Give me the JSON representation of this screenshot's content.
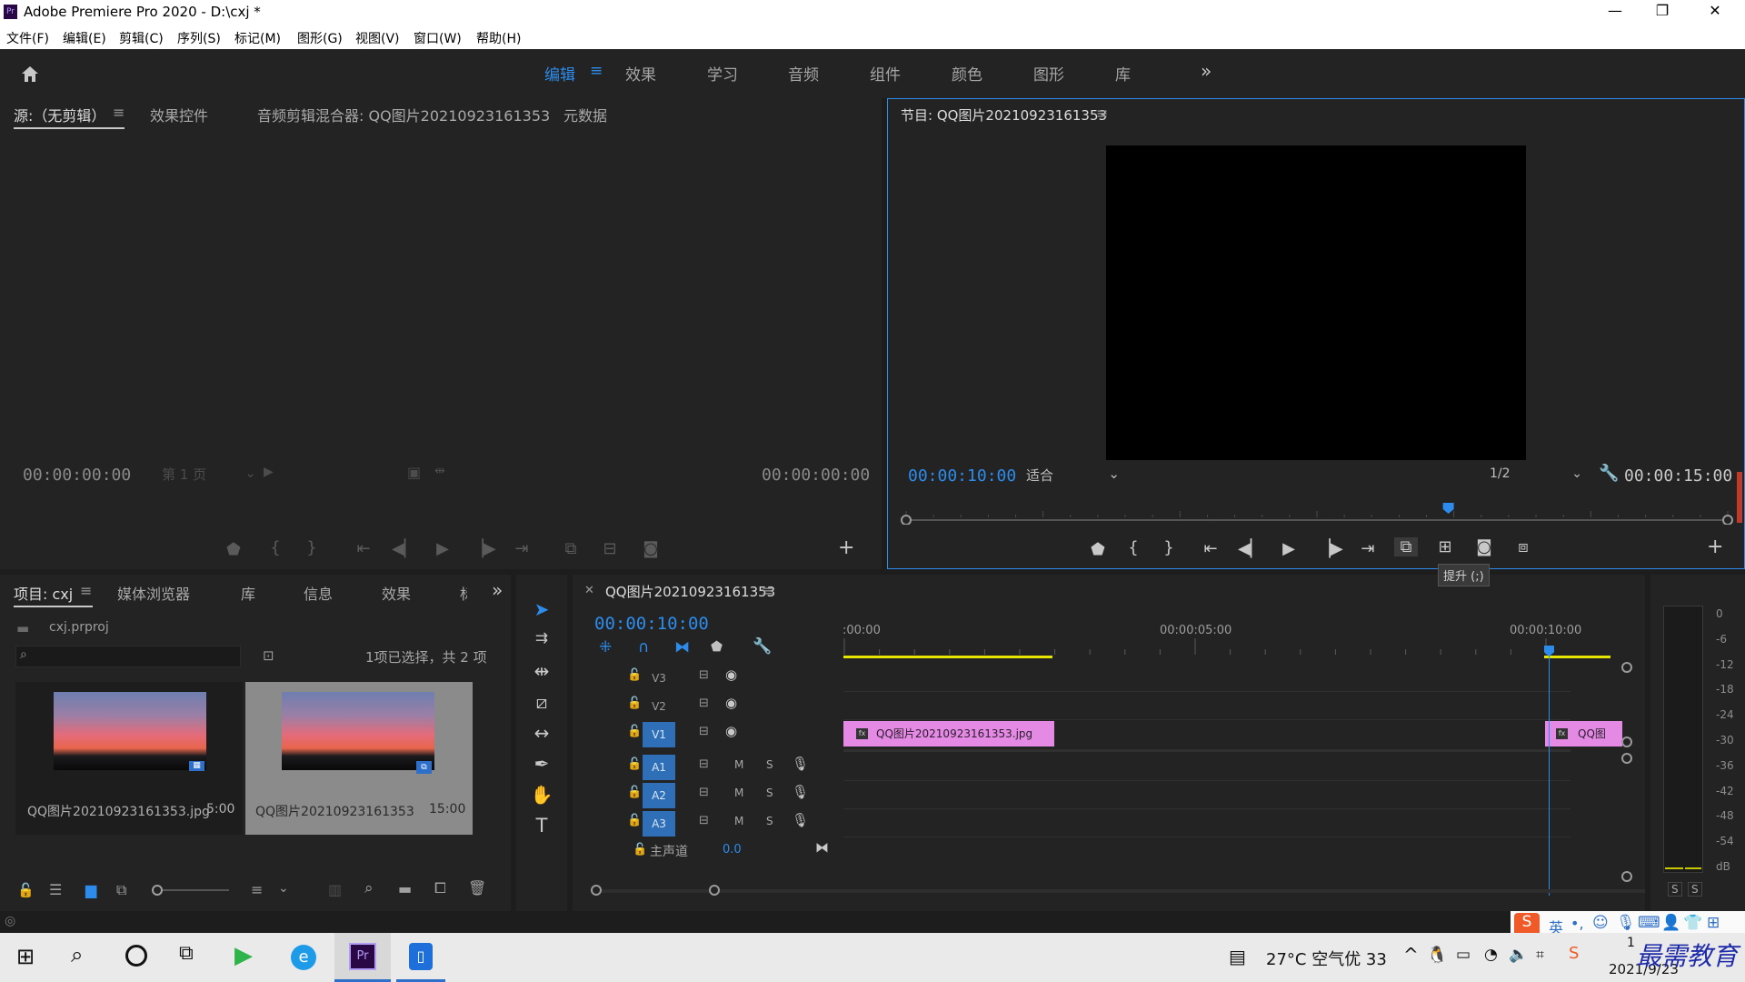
{
  "app": {
    "title": "Adobe Premiere Pro 2020 - D:\\cxj *"
  },
  "window_controls": {
    "minimize": "—",
    "maximize": "❐",
    "close": "✕"
  },
  "menu": [
    "文件(F)",
    "编辑(E)",
    "剪辑(C)",
    "序列(S)",
    "标记(M)",
    "图形(G)",
    "视图(V)",
    "窗口(W)",
    "帮助(H)"
  ],
  "workspaces": {
    "items": [
      "编辑",
      "效果",
      "学习",
      "音频",
      "组件",
      "颜色",
      "图形",
      "库"
    ],
    "active": "编辑",
    "more": "»"
  },
  "source_panel": {
    "tabs": [
      "源:（无剪辑）",
      "效果控件",
      "音频剪辑混合器: QQ图片20210923161353",
      "元数据"
    ],
    "tc_left": "00:00:00:00",
    "tc_right": "00:00:00:00",
    "page_select": "第 1 页"
  },
  "program_panel": {
    "title": "节目: QQ图片20210923161353",
    "tc_current": "00:00:10:00",
    "zoom": "适合",
    "resolution": "1/2",
    "tc_duration": "00:00:15:00",
    "tooltip": "提升 (;)",
    "playhead_fraction": 0.66
  },
  "project_panel": {
    "tabs": [
      "项目: cxj",
      "媒体浏览器",
      "库",
      "信息",
      "效果",
      "标"
    ],
    "file": "cxj.prproj",
    "selection_status": "1项已选择，共 2 项",
    "items": [
      {
        "name": "QQ图片20210923161353.jpg",
        "duration": "5:00",
        "selected": false
      },
      {
        "name": "QQ图片20210923161353",
        "duration": "15:00",
        "selected": true
      }
    ]
  },
  "timeline": {
    "title": "QQ图片20210923161353",
    "current_tc": "00:00:10:00",
    "ruler": [
      ":00:00",
      "00:00:05:00",
      "00:00:10:00"
    ],
    "tracks": {
      "video": [
        "V3",
        "V2",
        "V1"
      ],
      "audio": [
        "A1",
        "A2",
        "A3"
      ],
      "master": {
        "label": "主声道",
        "value": "0.0"
      }
    },
    "clips": [
      {
        "name": "QQ图片20210923161353.jpg",
        "track": "V1",
        "start": 0,
        "end": 3
      },
      {
        "name": "QQ图",
        "track": "V1",
        "start": 10,
        "end": 11.1
      }
    ],
    "playhead_seconds": 10
  },
  "meter": {
    "scale": [
      "0",
      "-6",
      "-12",
      "-18",
      "-24",
      "-30",
      "-36",
      "-42",
      "-48",
      "-54",
      "dB"
    ],
    "solo": [
      "S",
      "S"
    ]
  },
  "ime": {
    "label": "英"
  },
  "taskbar": {
    "weather": "27°C 空气优 33",
    "date": "2021/9/23",
    "time_fragment": "1",
    "watermark": "最需教育"
  },
  "colors": {
    "accent": "#2d8ceb",
    "clip": "#e48ae4",
    "track_button": "#2e6fb8",
    "work_area": "#e6e600",
    "premiere_icon": "#2a0846"
  }
}
